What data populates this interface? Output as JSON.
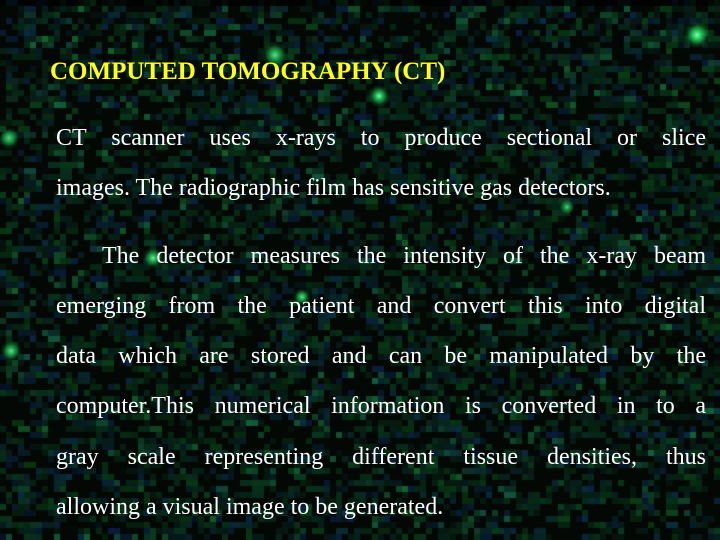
{
  "slide": {
    "title": "COMPUTED TOMOGRAPHY (CT)",
    "title_color": "#ffff1a",
    "text_color": "#ffffff",
    "background": "dark starfield with green specks",
    "paragraphs": [
      {
        "lines": [
          "CT scanner uses x-rays to produce sectional or slice",
          "images. The radiographic film has sensitive gas detectors."
        ]
      },
      {
        "lines": [
          "The detector measures the intensity of the x-ray beam",
          "emerging from the patient and convert this into digital",
          "data which are stored and can be manipulated by the",
          "computer.This numerical information is converted in to a",
          "gray scale representing different tissue densities, thus",
          "allowing a visual image to be generated."
        ]
      }
    ]
  }
}
